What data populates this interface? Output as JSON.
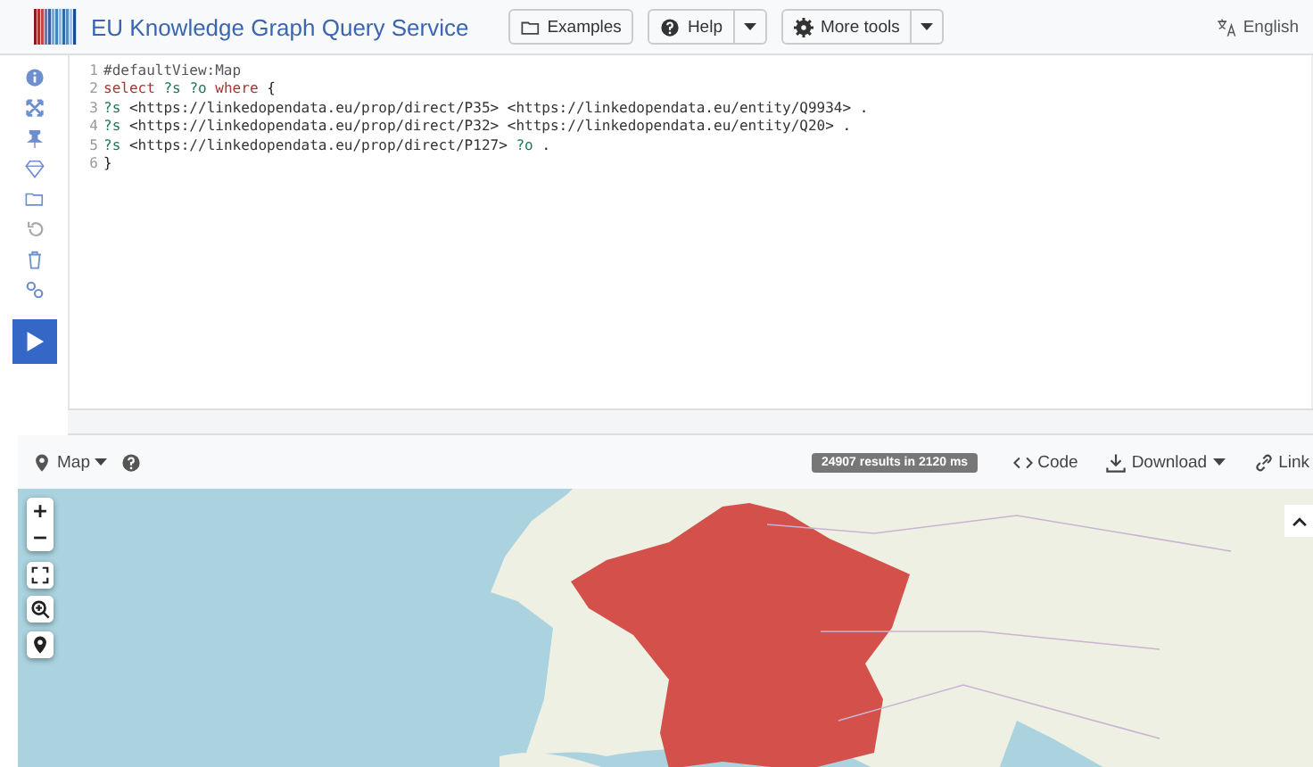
{
  "header": {
    "title": "EU Knowledge Graph Query Service",
    "buttons": [
      {
        "label": "Examples",
        "kind": "plain"
      },
      {
        "label": "Help",
        "kind": "split"
      },
      {
        "label": "More tools",
        "kind": "split"
      }
    ],
    "language": "English"
  },
  "editor": {
    "lines": [
      {
        "number": "1",
        "tokens": [
          {
            "text": "#defaultView:Map",
            "kind": "comment"
          }
        ]
      },
      {
        "number": "2",
        "tokens": [
          {
            "text": "select",
            "kind": "keyword"
          },
          {
            "text": "?s",
            "kind": "variable"
          },
          {
            "text": "?o",
            "kind": "variable"
          },
          {
            "text": "where",
            "kind": "keyword"
          },
          {
            "text": "{",
            "kind": "plain"
          }
        ]
      },
      {
        "number": "3",
        "tokens": [
          {
            "text": "?s",
            "kind": "variable"
          },
          {
            "text": "<https://linkedopendata.eu/prop/direct/P35>",
            "kind": "iri"
          },
          {
            "text": "<https://linkedopendata.eu/entity/Q9934>",
            "kind": "iri"
          },
          {
            "text": ".",
            "kind": "plain"
          }
        ]
      },
      {
        "number": "4",
        "tokens": [
          {
            "text": "?s",
            "kind": "variable"
          },
          {
            "text": "<https://linkedopendata.eu/prop/direct/P32>",
            "kind": "iri"
          },
          {
            "text": "<https://linkedopendata.eu/entity/Q20>",
            "kind": "iri"
          },
          {
            "text": ".",
            "kind": "plain"
          }
        ]
      },
      {
        "number": "5",
        "tokens": [
          {
            "text": "?s",
            "kind": "variable"
          },
          {
            "text": "<https://linkedopendata.eu/prop/direct/P127>",
            "kind": "iri"
          },
          {
            "text": "?o",
            "kind": "variable"
          },
          {
            "text": ".",
            "kind": "plain"
          }
        ]
      },
      {
        "number": "6",
        "tokens": [
          {
            "text": "}",
            "kind": "plain"
          }
        ]
      }
    ]
  },
  "results": {
    "view": "Map",
    "summary": "24907 results in 2120 ms",
    "actions": [
      {
        "label": "Code",
        "kind": "code"
      },
      {
        "label": "Download",
        "kind": "download"
      },
      {
        "label": "Link",
        "kind": "link"
      }
    ]
  }
}
